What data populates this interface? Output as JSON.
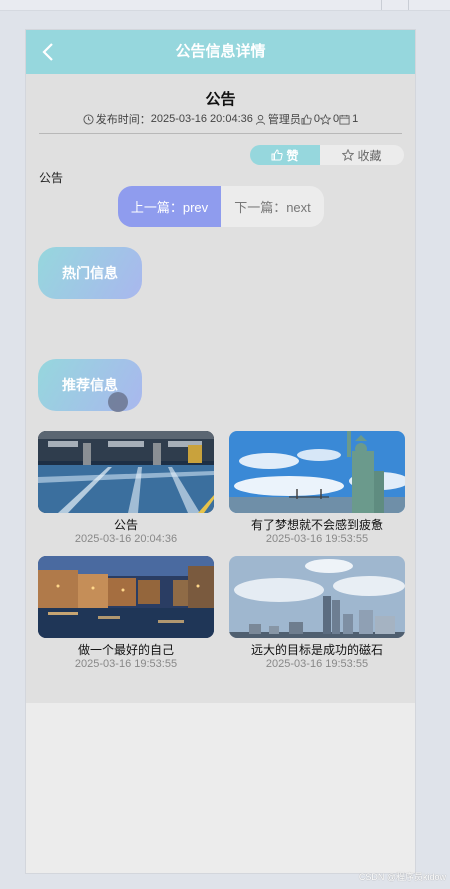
{
  "nav": {
    "title": "公告信息详情"
  },
  "article": {
    "title": "公告",
    "publish_label": "发布时间：",
    "publish_time": "2025-03-16 20:04:36",
    "author": "管理员",
    "likes": "0",
    "favorites": "0",
    "views": "1",
    "body": "公告"
  },
  "actions": {
    "like_label": "赞",
    "favorite_label": "收藏"
  },
  "pager": {
    "prev_label": "上一篇：prev",
    "next_label": "下一篇：next"
  },
  "sections": {
    "hot": "热门信息",
    "recommend": "推荐信息"
  },
  "cards": [
    {
      "title": "公告",
      "date": "2025-03-16 20:04:36",
      "image": "parking-garage"
    },
    {
      "title": "有了梦想就不会感到疲惫",
      "date": "2025-03-16 19:53:55",
      "image": "statue-of-liberty"
    },
    {
      "title": "做一个最好的自己",
      "date": "2025-03-16 19:53:55",
      "image": "venice-canal-night"
    },
    {
      "title": "远大的目标是成功的磁石",
      "date": "2025-03-16 19:53:55",
      "image": "city-skyline"
    }
  ],
  "colors": {
    "nav": "#96d7dd",
    "accent": "#8f9cee",
    "pill_end": "#a9b7ee"
  },
  "watermark": "CSDN @程序员kidow"
}
